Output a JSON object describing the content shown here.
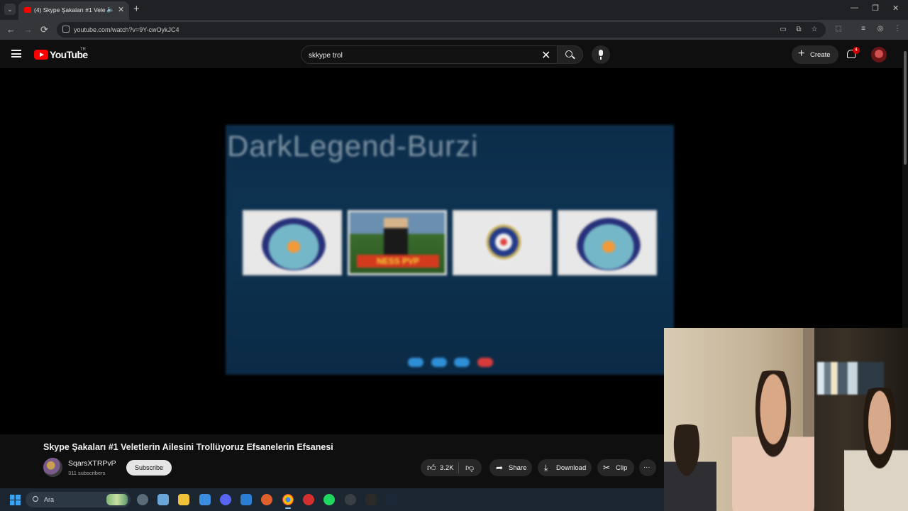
{
  "browser": {
    "tab_title": "(4) Skype Şakaları #1 Veletle",
    "url": "youtube.com/watch?v=9Y-cwOykJC4",
    "controls": {
      "minimize": "—",
      "restore": "❐",
      "close": "✕",
      "new_tab": "+",
      "back": "←",
      "forward": "→",
      "reload": "⟳"
    }
  },
  "masthead": {
    "logo_text": "YouTube",
    "country_code": "TR",
    "search_value": "skkype trol",
    "create_label": "Create",
    "notification_count": "4"
  },
  "video": {
    "frame_caption": "DarkLegend-Burzi",
    "banner_text": "NESS PVP"
  },
  "meta": {
    "title": "Skype Şakaları #1 Veletlerin Ailesini Trollüyoruz Efsanelerin Efsanesi",
    "channel_name": "SqarsXTRPvP",
    "subscribers": "311 subscribers",
    "subscribe_label": "Subscribe",
    "likes": "3.2K",
    "share_label": "Share",
    "download_label": "Download",
    "clip_label": "Clip",
    "more_label": "···"
  },
  "taskbar": {
    "search_label": "Ara"
  },
  "colors": {
    "accent_red": "#ff0000",
    "background": "#0f0f0f",
    "chip": "#272727"
  }
}
